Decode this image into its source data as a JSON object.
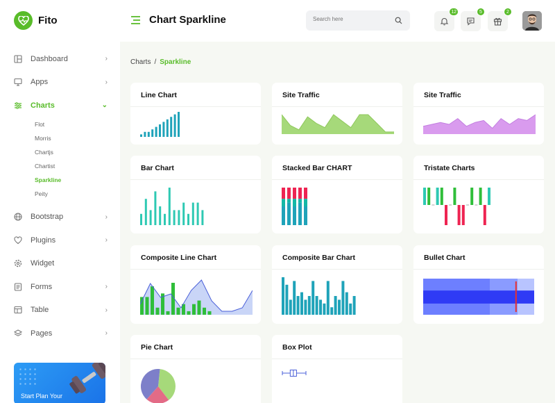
{
  "app": {
    "name": "Fito"
  },
  "header": {
    "title": "Chart Sparkline",
    "search_placeholder": "Search here",
    "notifications_count": "12",
    "messages_count": "5",
    "gifts_count": "2"
  },
  "sidebar": {
    "items": [
      {
        "label": "Dashboard",
        "icon": "dashboard-icon"
      },
      {
        "label": "Apps",
        "icon": "monitor-icon"
      },
      {
        "label": "Charts",
        "icon": "sliders-icon"
      },
      {
        "label": "Bootstrap",
        "icon": "globe-icon"
      },
      {
        "label": "Plugins",
        "icon": "heart-icon"
      },
      {
        "label": "Widget",
        "icon": "gear-icon"
      },
      {
        "label": "Forms",
        "icon": "form-icon"
      },
      {
        "label": "Table",
        "icon": "table-icon"
      },
      {
        "label": "Pages",
        "icon": "layers-icon"
      }
    ],
    "chart_subitems": [
      "Flot",
      "Morris",
      "Chartjs",
      "Chartist",
      "Sparkline",
      "Peity"
    ],
    "promo_text": "Start Plan Your"
  },
  "breadcrumb": {
    "parent": "Charts",
    "separator": "/",
    "current": "Sparkline"
  },
  "cards": {
    "line_chart": "Line Chart",
    "site_traffic_1": "Site Traffic",
    "site_traffic_2": "Site Traffic",
    "bar_chart": "Bar Chart",
    "stacked_bar": "Stacked Bar CHART",
    "tristate": "Tristate Charts",
    "composite_line": "Composite Line Chart",
    "composite_bar": "Composite Bar Chart",
    "bullet": "Bullet Chart",
    "pie": "Pie Chart",
    "box_plot": "Box Plot"
  },
  "colors": {
    "accent": "#59bc2a",
    "teal": "#1fa3b9",
    "cyan": "#2ec9b3",
    "crimson": "#ee2452",
    "green_area": "#a6d97a",
    "violet_area": "#d99bee",
    "bullet_light": "#b8c4ff",
    "bullet_mid": "#8a9bff",
    "bullet_bar": "#2f3bf5",
    "bullet_target": "#e8312f",
    "composite_green": "#2fbe3a",
    "composite_area": "#c9d5f7",
    "composite_line": "#4a5fd8"
  },
  "chart_data": [
    {
      "id": "line_chart",
      "type": "bar",
      "values": [
        1,
        2,
        2,
        3,
        4,
        5,
        6,
        7,
        8,
        9,
        10
      ]
    },
    {
      "id": "site_traffic_1",
      "type": "area",
      "values": [
        9,
        4,
        2,
        8,
        5,
        3,
        9,
        6,
        3,
        9,
        9,
        5,
        1,
        1
      ]
    },
    {
      "id": "site_traffic_2",
      "type": "area",
      "values": [
        4,
        5,
        6,
        5,
        8,
        4,
        6,
        7,
        3,
        8,
        5,
        8,
        7,
        10
      ]
    },
    {
      "id": "bar_chart",
      "type": "bar",
      "values": [
        3,
        7,
        4,
        9,
        5,
        3,
        10,
        4,
        4,
        6,
        3,
        6,
        6,
        4
      ]
    },
    {
      "id": "stacked_bar",
      "type": "bar-stacked",
      "series": [
        {
          "name": "",
          "values": [
            3,
            3,
            3,
            3,
            3
          ]
        },
        {
          "name": "",
          "values": [
            2,
            1,
            2,
            1,
            2
          ]
        },
        {
          "name": "",
          "values": [
            5,
            6,
            5,
            6,
            5
          ]
        }
      ]
    },
    {
      "id": "tristate",
      "type": "tristate",
      "values": [
        1,
        1,
        0,
        1,
        1,
        -1,
        0,
        1,
        -1,
        -1,
        0,
        1,
        0,
        1,
        -1,
        1
      ]
    },
    {
      "id": "composite_line",
      "type": "composite",
      "bars": [
        5,
        5,
        8,
        2,
        6,
        1,
        9,
        2,
        3,
        1,
        3,
        4,
        2,
        1
      ],
      "area": [
        3,
        9,
        5,
        6,
        2,
        7,
        10,
        4,
        1,
        1,
        2,
        7
      ]
    },
    {
      "id": "composite_bar",
      "type": "bar",
      "values": [
        10,
        8,
        4,
        9,
        5,
        6,
        4,
        5,
        9,
        5,
        4,
        3,
        9,
        2,
        5,
        4,
        9,
        6,
        3,
        5
      ]
    },
    {
      "id": "bullet",
      "type": "bullet",
      "range": [
        0,
        10
      ],
      "ranges": [
        10,
        8.5,
        6
      ],
      "value": 10,
      "target": 8.3
    },
    {
      "id": "pie",
      "type": "pie",
      "slices": [
        {
          "value": 38,
          "color": "#a6d97a"
        },
        {
          "value": 22,
          "color": "#e36b86"
        },
        {
          "value": 40,
          "color": "#7d7fc9"
        }
      ]
    },
    {
      "id": "box_plot",
      "type": "box",
      "min": 0,
      "q1": 2,
      "median": 2.8,
      "q3": 3.6,
      "max": 6,
      "outliers": []
    }
  ]
}
